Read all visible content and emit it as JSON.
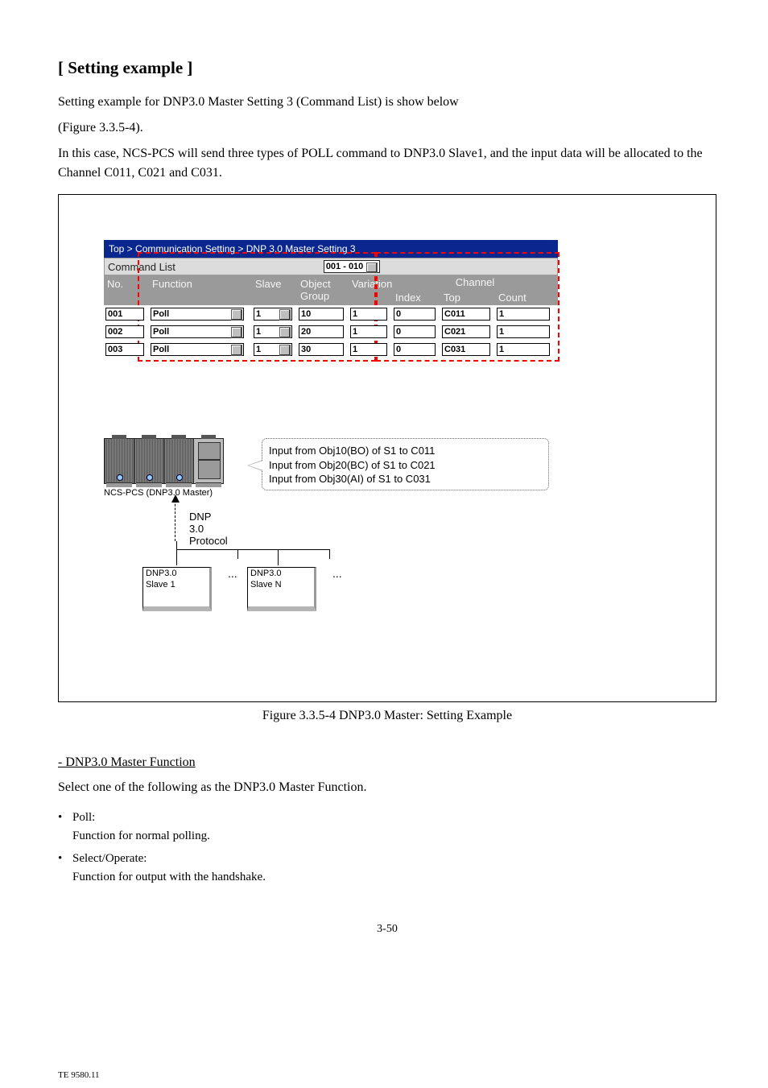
{
  "heading": "[ Setting example ]",
  "intro1": "Setting example for DNP3.0 Master Setting 3 (Command List) is show below",
  "intro2": "(Figure 3.3.5-4).",
  "intro3": "In this case, NCS-PCS will send three types of POLL command to DNP3.0 Slave1, and the input data will be allocated to the Channel C011, C021 and C031.",
  "win": {
    "title": "Top > Communication Setting > DNP 3.0 Master Setting 3",
    "subLabel": "Command List",
    "range": "001 - 010",
    "columns": {
      "no": "No.",
      "func": "Function",
      "slave": "Slave",
      "ogroup": "Object Group",
      "variation": "Variation",
      "channel": "Channel",
      "index": "Index",
      "top": "Top",
      "count": "Count"
    },
    "rows": [
      {
        "no": "001",
        "func": "Poll",
        "slave": "1",
        "ogroup": "10",
        "variation": "1",
        "index": "0",
        "top": "C011",
        "count": "1"
      },
      {
        "no": "002",
        "func": "Poll",
        "slave": "1",
        "ogroup": "20",
        "variation": "1",
        "index": "0",
        "top": "C021",
        "count": "1"
      },
      {
        "no": "003",
        "func": "Poll",
        "slave": "1",
        "ogroup": "30",
        "variation": "1",
        "index": "0",
        "top": "C031",
        "count": "1"
      }
    ]
  },
  "illus": {
    "ctrlLabel": "NCS-PCS (DNP3.0 Master)",
    "speech1": "Input from Obj10(BO) of S1 to C011",
    "speech2": "Input from Obj20(BC) of S1 to C021",
    "speech3": "Input from Obj30(AI) of S1 to C031",
    "arrowLabel": "DNP 3.0 Protocol",
    "el1": "...",
    "el2": "...",
    "dev1a": "DNP3.0",
    "dev1b": "Slave 1",
    "dev2a": "DNP3.0",
    "dev2b": "Slave N"
  },
  "caption": "Figure 3.3.5-4  DNP3.0 Master: Setting Example",
  "subheading": "- DNP3.0 Master Function",
  "bullet": "Select one of the following as the DNP3.0 Master Function.",
  "listPoll": "Poll:",
  "listPoll2": "Function for normal polling.",
  "listSelOp": "Select/Operate:",
  "listSelOp2": "Function for output with the handshake.",
  "pageNum": "3-50",
  "docCode": "TE 9580.11"
}
